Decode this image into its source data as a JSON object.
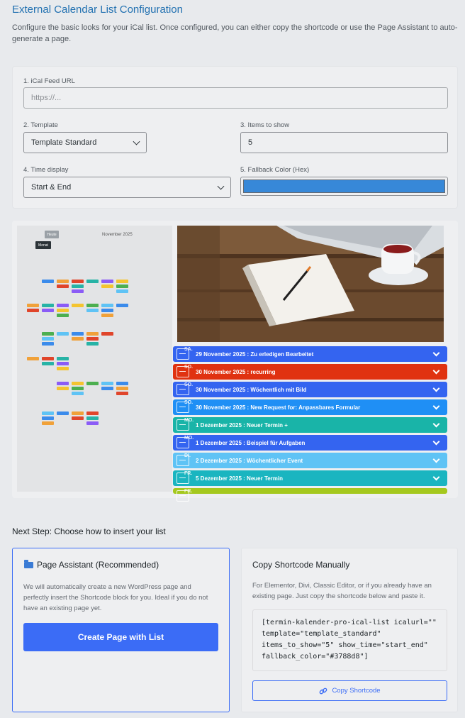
{
  "header": {
    "title": "External Calendar List Configuration",
    "description": "Configure the basic looks for your iCal list. Once configured, you can either copy the shortcode or use the Page Assistant to auto-generate a page."
  },
  "form": {
    "feed_url": {
      "label": "1. iCal Feed URL",
      "placeholder": "https://..."
    },
    "template": {
      "label": "2. Template",
      "value": "Template Standard"
    },
    "items": {
      "label": "3. Items to show",
      "value": "5"
    },
    "time_display": {
      "label": "4. Time display",
      "value": "Start & End"
    },
    "fallback_color": {
      "label": "5. Fallback Color (Hex)",
      "value": "#3788d8"
    }
  },
  "preview": {
    "calendar": {
      "today_button": "Heute",
      "month_button": "Monat",
      "month_title": "November 2025"
    },
    "rows": [
      {
        "day": "SA.",
        "text": "29 November 2025 : Zu erledigen Bearbeitet",
        "color": "#3464f0"
      },
      {
        "day": "SO.",
        "text": "30 November 2025 : recurring",
        "color": "#e03210"
      },
      {
        "day": "SO.",
        "text": "30 November 2025 : Wöchentlich mit Bild",
        "color": "#3464f0"
      },
      {
        "day": "SO.",
        "text": "30 November 2025 : New Request for: Anpassbares Formular",
        "color": "#1f8ff5"
      },
      {
        "day": "MO.",
        "text": "1 Dezember 2025 : Neuer Termin +",
        "color": "#19b4a8"
      },
      {
        "day": "MO.",
        "text": "1 Dezember 2025 : Beispiel für Aufgaben",
        "color": "#3464f0"
      },
      {
        "day": "DI.",
        "text": "2 Dezember 2025 : Wöchentlicher Event",
        "color": "#5fc3f5"
      },
      {
        "day": "FR.",
        "text": "5 Dezember 2025 : Neuer Termin",
        "color": "#1ab5c0"
      },
      {
        "day": "FR.",
        "text": "",
        "color": "#a5c81e"
      }
    ]
  },
  "next_step": "Next Step: Choose how to insert your list",
  "assistant": {
    "title": "Page Assistant (Recommended)",
    "text": "We will automatically create a new WordPress page and perfectly insert the Shortcode block for you. Ideal if you do not have an existing page yet.",
    "button": "Create Page with List"
  },
  "manual": {
    "title": "Copy Shortcode Manually",
    "text": "For Elementor, Divi, Classic Editor, or if you already have an existing page. Just copy the shortcode below and paste it.",
    "shortcode": "[termin-kalender-pro-ical-list icalurl=\"\"\ntemplate=\"template_standard\"\nitems_to_show=\"5\" show_time=\"start_end\"\nfallback_color=\"#3788d8\"]",
    "button": "Copy Shortcode"
  }
}
